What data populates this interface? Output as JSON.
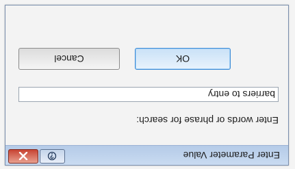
{
  "window": {
    "title": "Enter Parameter Value",
    "help_icon": "help-question-icon",
    "close_icon": "close-x-icon"
  },
  "form": {
    "prompt": "Enter words or phrase for search:",
    "input_value": "barriers to entry"
  },
  "buttons": {
    "ok_label": "OK",
    "cancel_label": "Cancel"
  },
  "colors": {
    "titlebar": "#c1d5ee",
    "close_button": "#c74433",
    "ok_border": "#3c8bd6"
  }
}
